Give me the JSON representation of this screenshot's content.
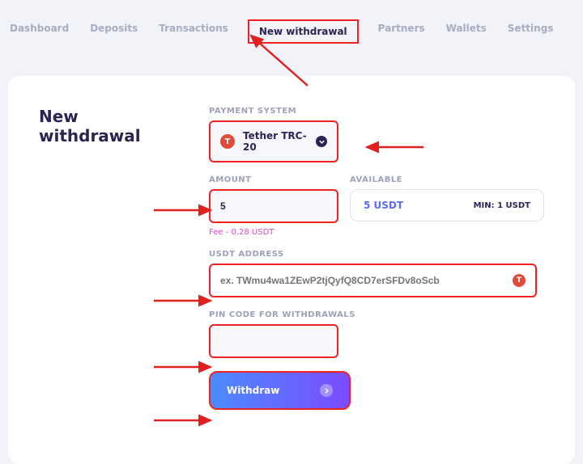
{
  "nav": {
    "items": [
      "Dashboard",
      "Deposits",
      "Transactions",
      "New withdrawal",
      "Partners",
      "Wallets",
      "Settings"
    ],
    "activeIndex": 3
  },
  "page": {
    "title": "New withdrawal"
  },
  "form": {
    "paymentSystem": {
      "label": "PAYMENT SYSTEM",
      "selected": "Tether TRC-20",
      "iconLetter": "T"
    },
    "amount": {
      "label": "AMOUNT",
      "value": "5",
      "feeText": "Fee - 0.28 USDT"
    },
    "available": {
      "label": "AVAILABLE",
      "value": "5 USDT",
      "minPrefix": "MIN:",
      "minValue": "1 USDT"
    },
    "address": {
      "label": "USDT ADDRESS",
      "placeholder": "ex. TWmu4wa1ZEwP2tjQyfQ8CD7erSFDv8oScb"
    },
    "pin": {
      "label": "PIN CODE FOR WITHDRAWALS",
      "value": ""
    },
    "submitLabel": "Withdraw"
  },
  "annotationColor": "#e22020"
}
